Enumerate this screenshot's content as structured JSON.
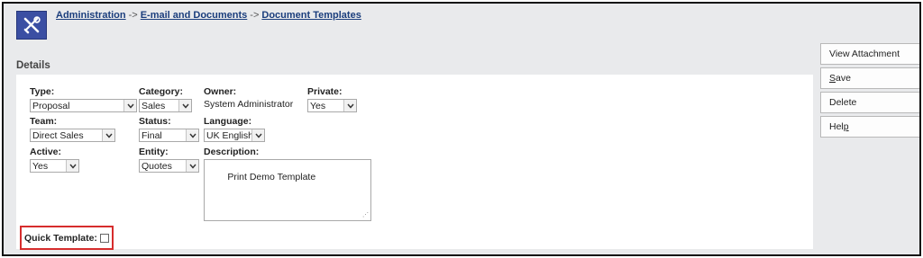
{
  "breadcrumb": {
    "items": [
      "Administration",
      "E-mail and Documents",
      "Document Templates"
    ],
    "separator": "->"
  },
  "section_title": "Details",
  "form": {
    "type": {
      "label": "Type:",
      "value": "Proposal"
    },
    "category": {
      "label": "Category:",
      "value": "Sales"
    },
    "owner": {
      "label": "Owner:",
      "value": "System Administrator"
    },
    "private": {
      "label": "Private:",
      "value": "Yes"
    },
    "team": {
      "label": "Team:",
      "value": "Direct Sales"
    },
    "status": {
      "label": "Status:",
      "value": "Final"
    },
    "language": {
      "label": "Language:",
      "value": "UK English"
    },
    "active": {
      "label": "Active:",
      "value": "Yes"
    },
    "entity": {
      "label": "Entity:",
      "value": "Quotes"
    },
    "description": {
      "label": "Description:",
      "value": "Print Demo Template"
    },
    "quick_template": {
      "label": "Quick Template:",
      "checked": false
    }
  },
  "actions": {
    "view_attachment": "View Attachment",
    "save": {
      "pre": "",
      "key": "S",
      "post": "ave"
    },
    "delete": "Delete",
    "help": {
      "pre": "Hel",
      "key": "p",
      "post": ""
    }
  },
  "icons": {
    "logo": "tools-icon",
    "dropdown": "chevron-down-icon",
    "resize": "resize-grip-icon"
  },
  "colors": {
    "logo_bg": "#3b4fa3",
    "link": "#1a3d7c",
    "highlight": "#d62d2d",
    "page_bg": "#e9eaec"
  }
}
